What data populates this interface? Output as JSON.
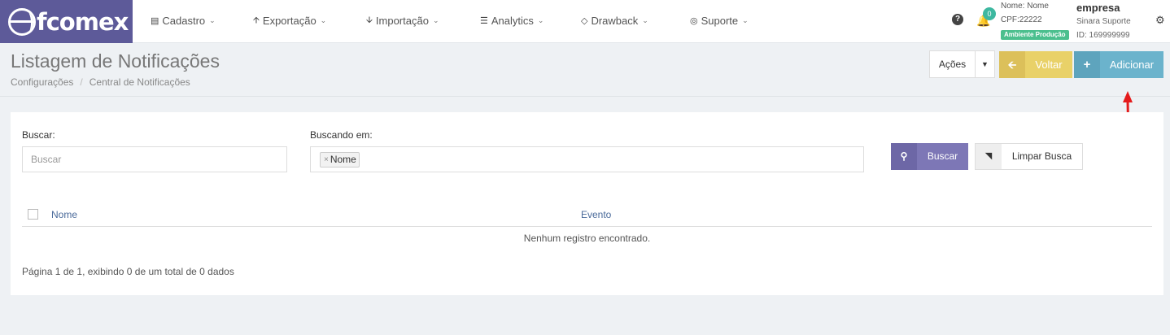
{
  "brand": {
    "logo_text": "fcomex"
  },
  "nav": [
    {
      "label": "Cadastro"
    },
    {
      "label": "Exportação"
    },
    {
      "label": "Importação"
    },
    {
      "label": "Analytics"
    },
    {
      "label": "Drawback"
    },
    {
      "label": "Suporte"
    }
  ],
  "user": {
    "notifications_count": "0",
    "name": "Nome: Nome",
    "cpf": "CPF:22222",
    "environment": "Ambiente Produção",
    "company": "empresa",
    "support_user": "Sinara Suporte",
    "id": "ID: 169999999"
  },
  "page": {
    "title": "Listagem de Notificações",
    "breadcrumb": [
      "Configurações",
      "Central de Notificações"
    ],
    "actions_label": "Ações",
    "back_label": "Voltar",
    "add_label": "Adicionar"
  },
  "search": {
    "search_label": "Buscar:",
    "search_placeholder": "Buscar",
    "searching_in_label": "Buscando em:",
    "searching_in_tag": "Nome",
    "search_button": "Buscar",
    "clear_button": "Limpar Busca"
  },
  "table": {
    "columns": [
      "Nome",
      "Evento"
    ],
    "empty_message": "Nenhum registro encontrado.",
    "pagination_text": "Página 1 de 1, exibindo 0 de um total de 0 dados"
  },
  "colors": {
    "brand": "#5d5a99",
    "voltar": "#e9d168",
    "adicionar": "#6bb3cc",
    "buscar": "#7d77b6",
    "annotation": "#e41b1b"
  }
}
